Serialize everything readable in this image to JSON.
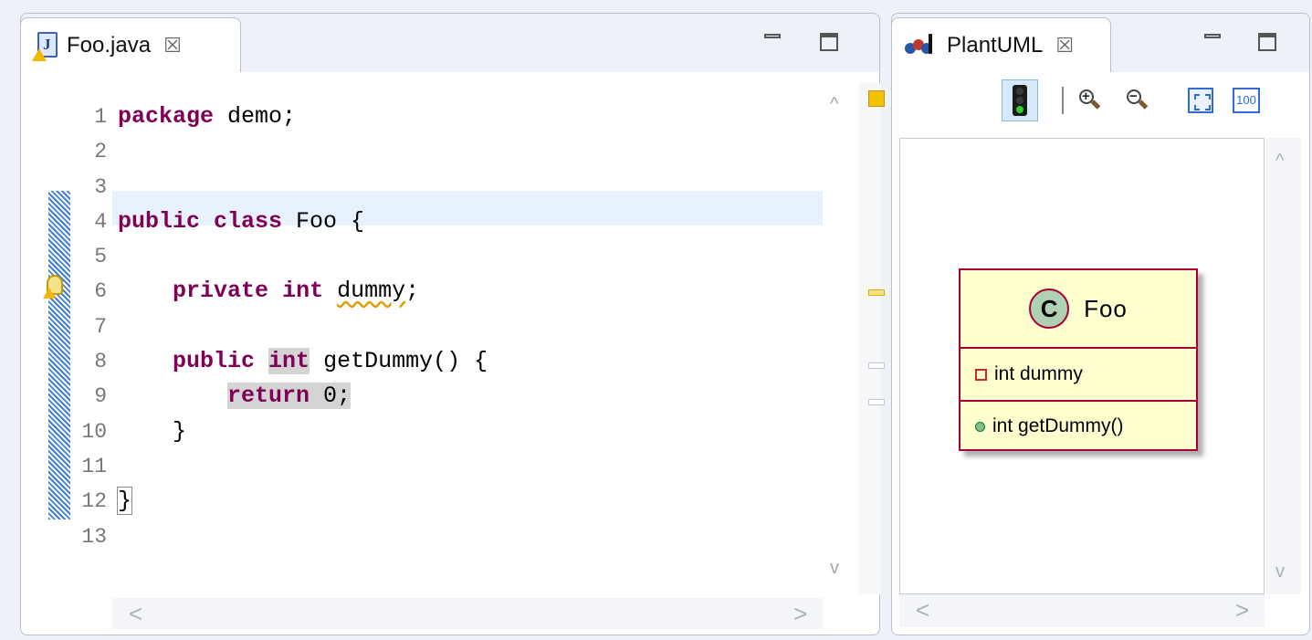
{
  "editor": {
    "tab_title": "Foo.java",
    "tab_close_glyph": "☒",
    "file_icon_letter": "J",
    "line_numbers": [
      "1",
      "2",
      "3",
      "4",
      "5",
      "6",
      "7",
      "8",
      "9",
      "10",
      "11",
      "12",
      "13"
    ],
    "lines": [
      [
        {
          "t": "package",
          "c": "kw"
        },
        {
          "t": " demo;"
        }
      ],
      [],
      [],
      [
        {
          "t": "public",
          "c": "kw"
        },
        {
          "t": " "
        },
        {
          "t": "class",
          "c": "kw"
        },
        {
          "t": " Foo {"
        }
      ],
      [],
      [
        {
          "t": "    "
        },
        {
          "t": "private",
          "c": "kw"
        },
        {
          "t": " "
        },
        {
          "t": "int",
          "c": "kw"
        },
        {
          "t": " "
        },
        {
          "t": "dummy",
          "c": "warn-underline"
        },
        {
          "t": ";"
        }
      ],
      [],
      [
        {
          "t": "    "
        },
        {
          "t": "public",
          "c": "kw"
        },
        {
          "t": " "
        },
        {
          "t": "int",
          "c": "kw hl"
        },
        {
          "t": " getDummy() {"
        }
      ],
      [
        {
          "t": "        "
        },
        {
          "t": "return",
          "c": "kw hl"
        },
        {
          "t": " 0;",
          "c": "hl"
        }
      ],
      [
        {
          "t": "    }"
        }
      ],
      [],
      [
        {
          "t": "}",
          "c": "bracket-box"
        }
      ],
      []
    ],
    "scroll_left_glyph": "<",
    "scroll_right_glyph": ">",
    "scroll_up_glyph": "^",
    "scroll_down_glyph": "v",
    "ruler_marks": [
      {
        "color": "#f5e08a",
        "border": "#d9b200"
      },
      {
        "color": "#ffffff",
        "border": "#c7cbd1"
      },
      {
        "color": "#ffffff",
        "border": "#c7cbd1"
      }
    ]
  },
  "plantuml": {
    "tab_title": "PlantUML",
    "tab_close_glyph": "☒",
    "toolbar": {
      "zoom_in_sign": "+",
      "zoom_out_sign": "−",
      "zoom_100_label": "100"
    },
    "class": {
      "badge": "C",
      "name": "Foo",
      "field": "int dummy",
      "method": "int getDummy()"
    },
    "scroll_left_glyph": "<",
    "scroll_right_glyph": ">",
    "scroll_up_glyph": "^",
    "scroll_down_glyph": "v"
  },
  "colors": {
    "keyword": "#7f0055",
    "current_line": "#e8f2fe",
    "uml_border": "#a80036",
    "uml_fill": "#fefece",
    "uml_badge": "#add1b2"
  }
}
